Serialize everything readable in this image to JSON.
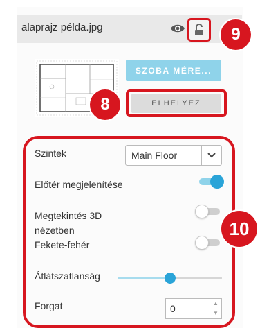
{
  "header": {
    "filename": "alaprajz példa.jpg",
    "icons": {
      "visibility": "eye-icon",
      "lock": "lock-icon"
    }
  },
  "buttons": {
    "room_size_label": "SZOBA MÉRE...",
    "place_label": "ELHELYEZ"
  },
  "settings": {
    "levels_label": "Szintek",
    "levels_value": "Main Floor",
    "show_foreground_label": "Előtér megjelenítése",
    "show_foreground_on": true,
    "view_3d_label_line1": "Megtekintés 3D",
    "view_3d_label_line2": "nézetben",
    "view_3d_on": false,
    "black_white_label": "Fekete-fehér",
    "black_white_on": false,
    "opacity_label": "Átlátszatlanság",
    "opacity_value": 0.5,
    "rotate_label": "Forgat",
    "rotate_value": "0"
  },
  "annotations": {
    "badge_8": "8",
    "badge_9": "9",
    "badge_10": "10"
  },
  "colors": {
    "accent_blue": "#2aa4d8",
    "light_blue": "#8fd3ea",
    "highlight_red": "#d7161f"
  }
}
